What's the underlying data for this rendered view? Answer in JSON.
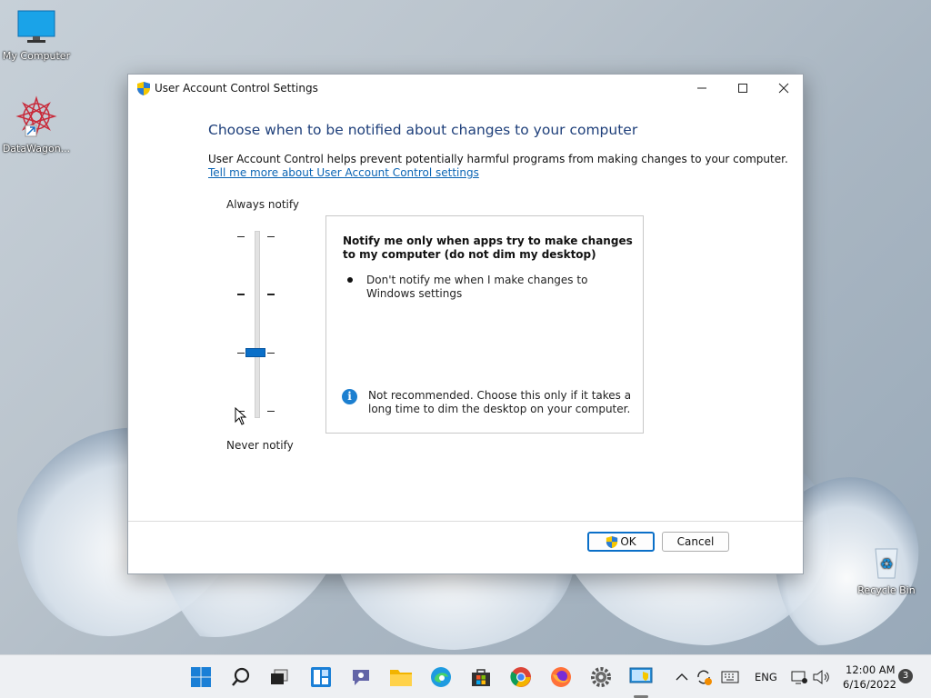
{
  "desktop": {
    "icons": [
      {
        "label": "My Computer",
        "icon": "monitor-icon"
      },
      {
        "label": "DataWagon...",
        "icon": "datawagon-icon"
      },
      {
        "label": "Recycle Bin",
        "icon": "recycle-bin-icon"
      }
    ]
  },
  "window": {
    "title": "User Account Control Settings",
    "heading": "Choose when to be notified about changes to your computer",
    "description": "User Account Control helps prevent potentially harmful programs from making changes to your computer.",
    "link": "Tell me more about User Account Control settings",
    "slider": {
      "top_label": "Always notify",
      "bottom_label": "Never notify",
      "levels": 4,
      "selected_level": 3
    },
    "info": {
      "title": "Notify me only when apps try to make changes to my computer (do not dim my desktop)",
      "bullet": "Don't notify me when I make changes to Windows settings",
      "note": "Not recommended. Choose this only if it takes a long time to dim the desktop on your computer."
    },
    "buttons": {
      "ok": "OK",
      "cancel": "Cancel"
    }
  },
  "taskbar": {
    "apps": [
      "start-icon",
      "search-icon",
      "task-view-icon",
      "widgets-icon",
      "chat-icon",
      "file-explorer-icon",
      "edge-icon",
      "store-icon",
      "chrome-icon",
      "firefox-icon",
      "settings-icon",
      "uac-settings-icon"
    ],
    "tray": {
      "language": "ENG",
      "time": "12:00 AM",
      "date": "6/16/2022",
      "notifications": "3"
    }
  }
}
